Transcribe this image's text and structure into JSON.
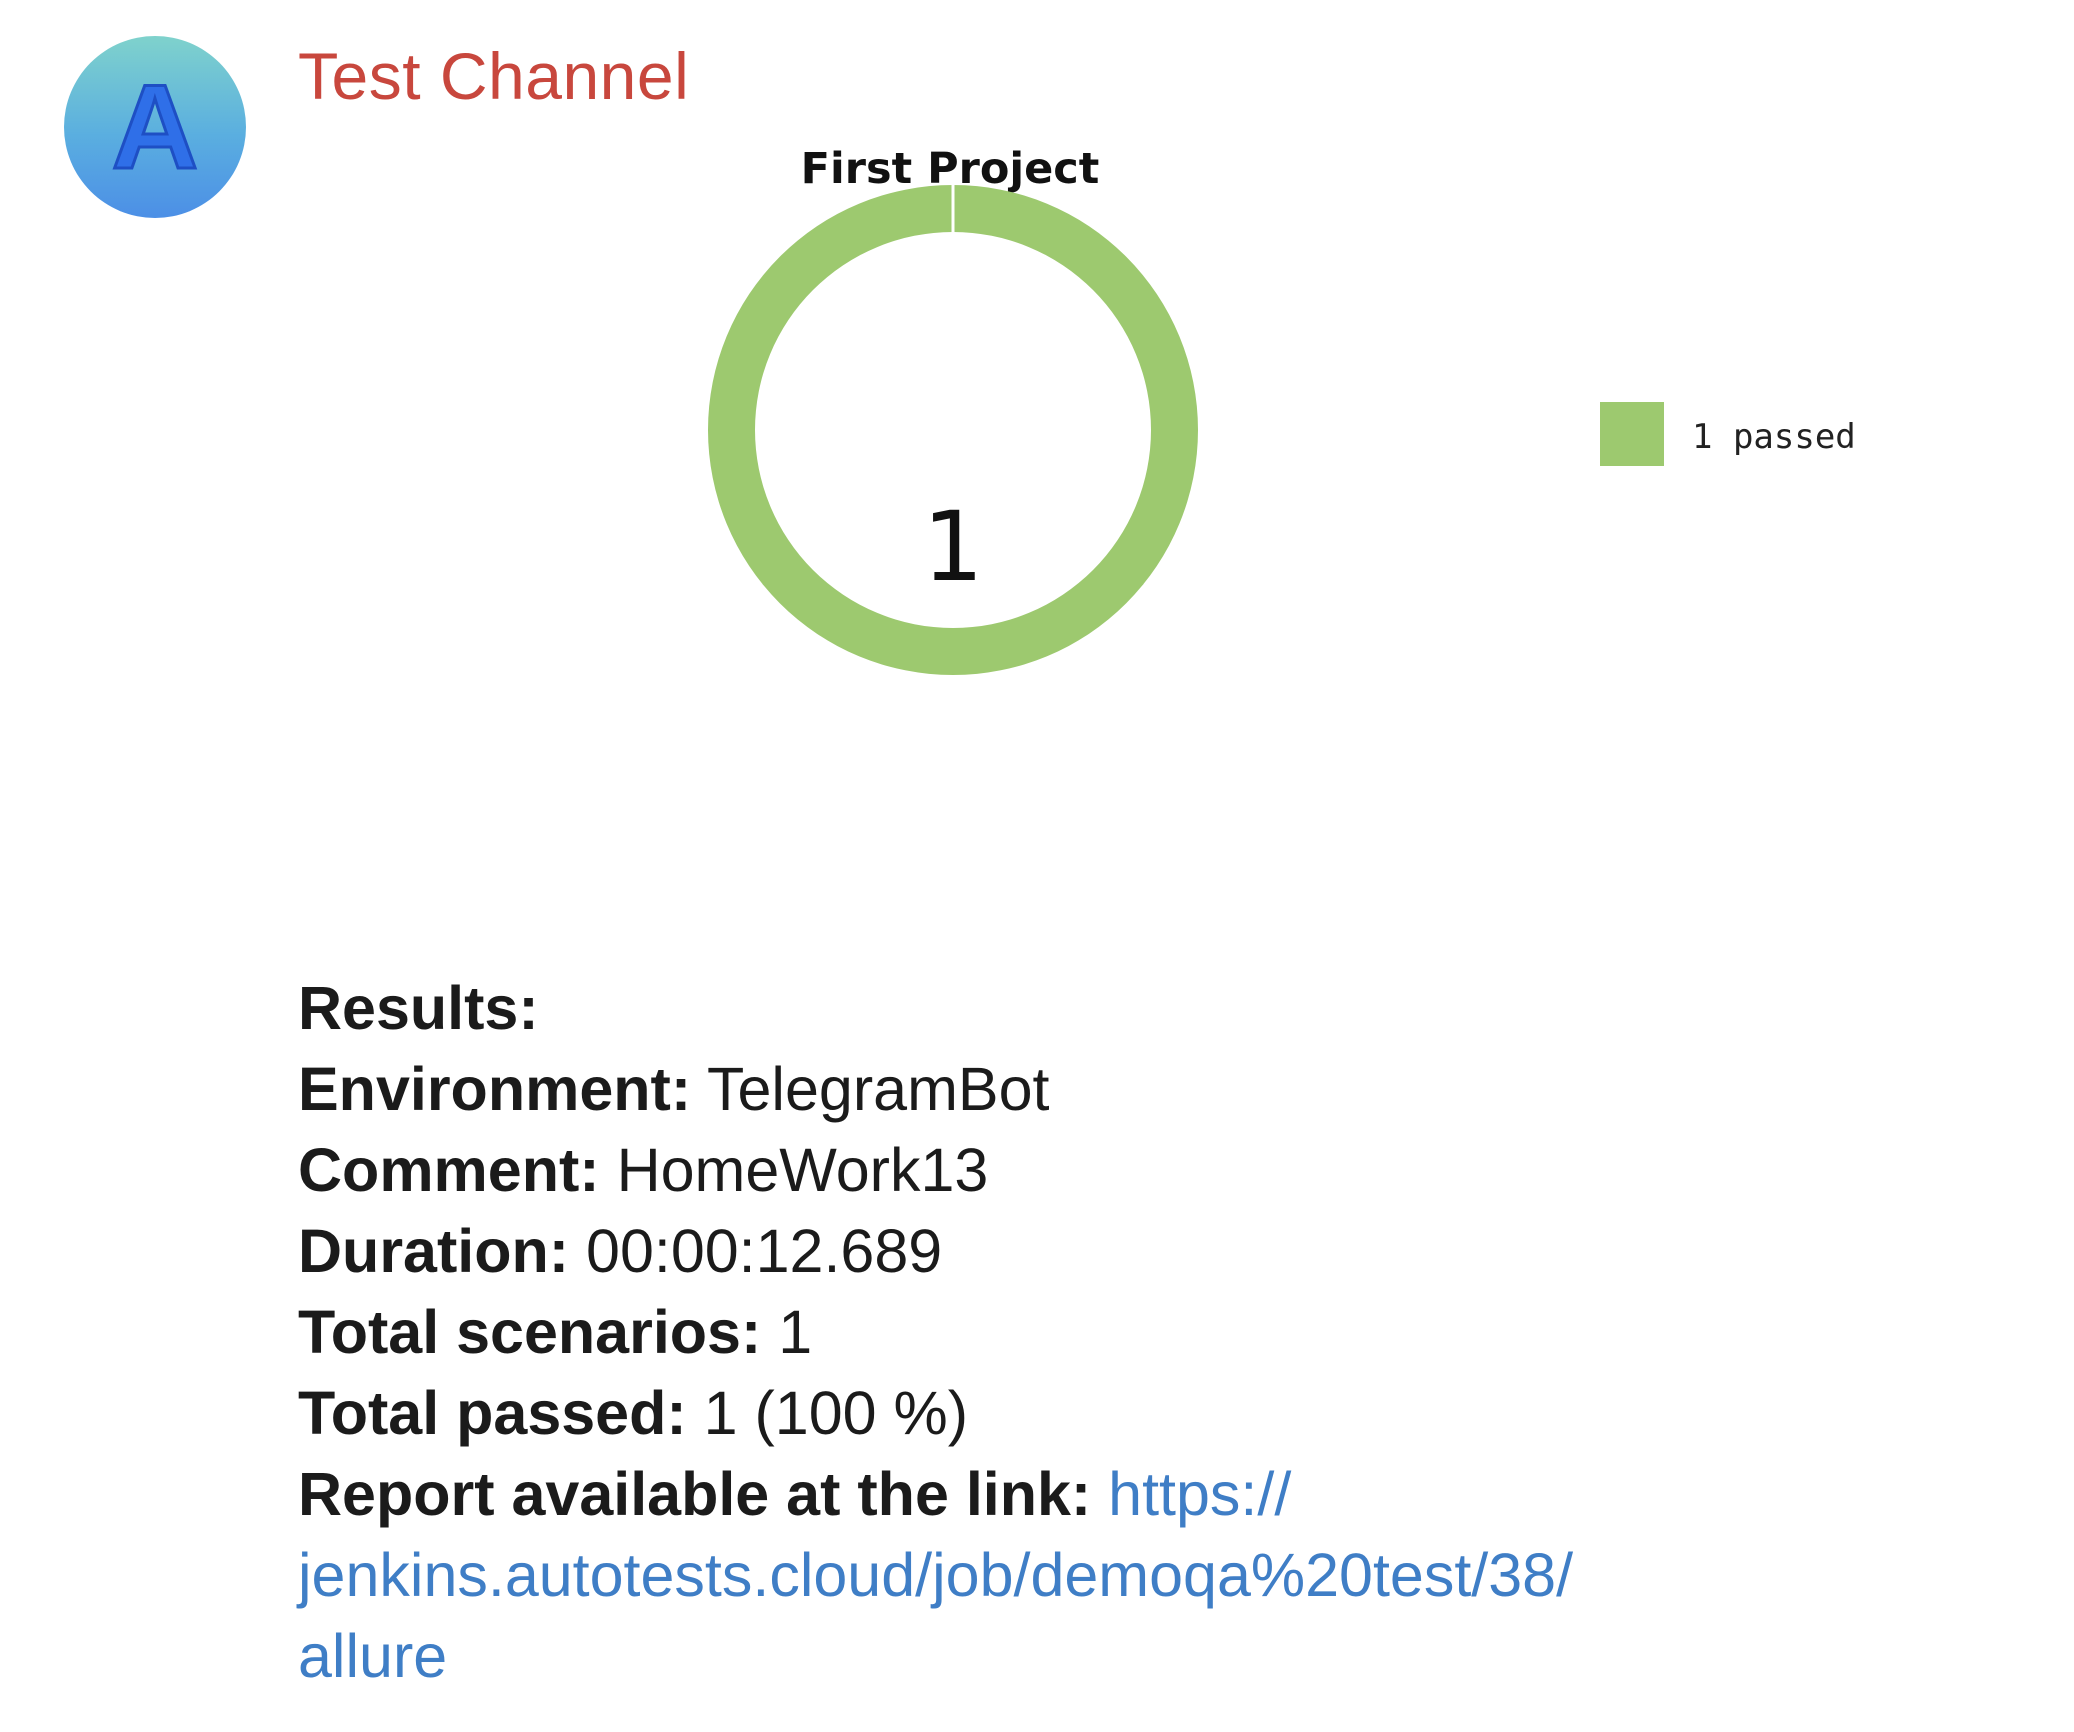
{
  "channel": {
    "name": "Test Channel",
    "avatar_letter": "A",
    "avatar_colors": [
      "#7fd2cc",
      "#4c8fe6"
    ],
    "name_color": "#c8473d"
  },
  "chart_data": {
    "type": "pie",
    "style": "donut",
    "title": "First Project",
    "center_label": "1",
    "slices": [
      {
        "label": "1 passed",
        "value": 1,
        "color": "#9dc96f"
      }
    ],
    "legend": {
      "placement": "right",
      "entries": [
        "1 passed"
      ]
    }
  },
  "message": {
    "results_label": "Results:",
    "rows": [
      {
        "label": "Environment:",
        "value": "TelegramBot"
      },
      {
        "label": "Comment:",
        "value": "HomeWork13"
      },
      {
        "label": "Duration:",
        "value": "00:00:12.689"
      },
      {
        "label": "Total scenarios:",
        "value": "1"
      },
      {
        "label": "Total passed:",
        "value": "1 (100 %)"
      }
    ],
    "report_label": "Report available at the link:",
    "report_link_part1": "https://",
    "report_link_part2": "jenkins.autotests.cloud/job/demoqa%20test/38/",
    "report_link_part3": "allure",
    "link_color": "#3f7ec6"
  }
}
